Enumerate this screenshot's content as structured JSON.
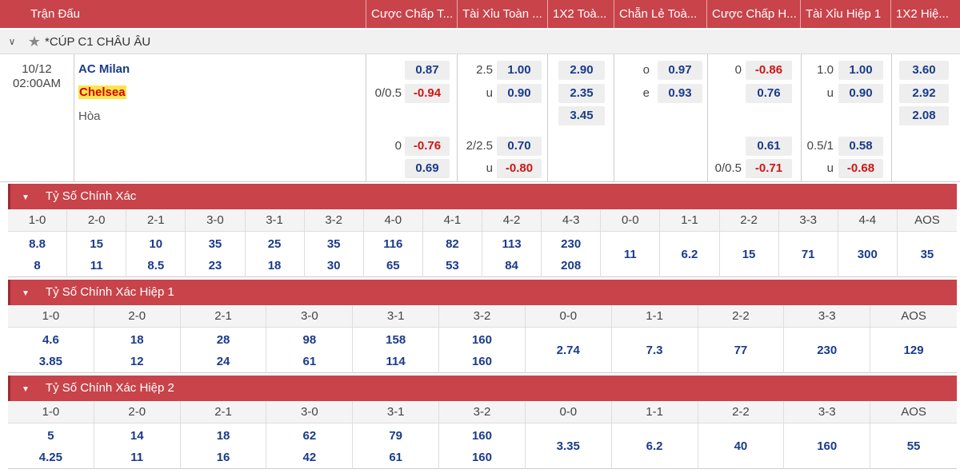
{
  "header": {
    "columns": [
      "Trận Đấu",
      "Cược Chấp T...",
      "Tài Xỉu Toàn ...",
      "1X2 Toà...",
      "Chẵn Lẻ Toà...",
      "Cược Chấp H...",
      "Tài Xỉu Hiệp 1",
      "1X2 Hiệ..."
    ]
  },
  "league": {
    "chevron": "chevron-down",
    "star": "star",
    "name": "*CÚP C1 CHÂU ÂU"
  },
  "match": {
    "date": "10/12",
    "time": "02:00AM",
    "home": "AC Milan",
    "away": "Chelsea",
    "draw": "Hòa",
    "main": {
      "hdp_ft": [
        {
          "label": "",
          "home": "0.87",
          "away": "-0.94",
          "away_label": "0/0.5"
        },
        {
          "label": "0",
          "home": "-0.76",
          "away": "0.69",
          "away_label": ""
        }
      ],
      "ou_ft": [
        {
          "line": "2.5",
          "over": "1.00",
          "under_label": "u",
          "under": "0.90"
        },
        {
          "line": "2/2.5",
          "over": "0.70",
          "under_label": "u",
          "under": "-0.80"
        }
      ],
      "x12_ft": [
        "2.90",
        "2.35",
        "3.45"
      ],
      "oe_ft": [
        {
          "label": "o",
          "val": "0.97"
        },
        {
          "label": "e",
          "val": "0.93"
        }
      ],
      "hdp_h1": [
        {
          "label": "0",
          "home": "-0.86",
          "away": "0.76",
          "away_label": ""
        },
        {
          "label": "",
          "home": "0.61",
          "away": "-0.71",
          "away_label": "0/0.5"
        }
      ],
      "ou_h1": [
        {
          "line": "1.0",
          "over": "1.00",
          "under_label": "u",
          "under": "0.90"
        },
        {
          "line": "0.5/1",
          "over": "0.58",
          "under_label": "u",
          "under": "-0.68"
        }
      ],
      "x12_h1": [
        "3.60",
        "2.92",
        "2.08"
      ]
    }
  },
  "sections": [
    {
      "title": "Tỷ Số Chính Xác",
      "headers": [
        "1-0",
        "2-0",
        "2-1",
        "3-0",
        "3-1",
        "3-2",
        "4-0",
        "4-1",
        "4-2",
        "4-3",
        "0-0",
        "1-1",
        "2-2",
        "3-3",
        "4-4",
        "AOS"
      ],
      "values": [
        [
          "8.8",
          "8"
        ],
        [
          "15",
          "11"
        ],
        [
          "10",
          "8.5"
        ],
        [
          "35",
          "23"
        ],
        [
          "25",
          "18"
        ],
        [
          "35",
          "30"
        ],
        [
          "116",
          "65"
        ],
        [
          "82",
          "53"
        ],
        [
          "113",
          "84"
        ],
        [
          "230",
          "208"
        ],
        [
          "11"
        ],
        [
          "6.2"
        ],
        [
          "15"
        ],
        [
          "71"
        ],
        [
          "300"
        ],
        [
          "35"
        ]
      ]
    },
    {
      "title": "Tỷ Số Chính Xác Hiệp 1",
      "headers": [
        "1-0",
        "2-0",
        "2-1",
        "3-0",
        "3-1",
        "3-2",
        "0-0",
        "1-1",
        "2-2",
        "3-3",
        "AOS"
      ],
      "values": [
        [
          "4.6",
          "3.85"
        ],
        [
          "18",
          "12"
        ],
        [
          "28",
          "24"
        ],
        [
          "98",
          "61"
        ],
        [
          "158",
          "114"
        ],
        [
          "160",
          "160"
        ],
        [
          "2.74"
        ],
        [
          "7.3"
        ],
        [
          "77"
        ],
        [
          "230"
        ],
        [
          "129"
        ]
      ]
    },
    {
      "title": "Tỷ Số Chính Xác Hiệp 2",
      "headers": [
        "1-0",
        "2-0",
        "2-1",
        "3-0",
        "3-1",
        "3-2",
        "0-0",
        "1-1",
        "2-2",
        "3-3",
        "AOS"
      ],
      "values": [
        [
          "5",
          "4.25"
        ],
        [
          "14",
          "11"
        ],
        [
          "18",
          "16"
        ],
        [
          "62",
          "42"
        ],
        [
          "79",
          "61"
        ],
        [
          "160",
          "160"
        ],
        [
          "3.35"
        ],
        [
          "6.2"
        ],
        [
          "40"
        ],
        [
          "160"
        ],
        [
          "55"
        ]
      ]
    }
  ]
}
